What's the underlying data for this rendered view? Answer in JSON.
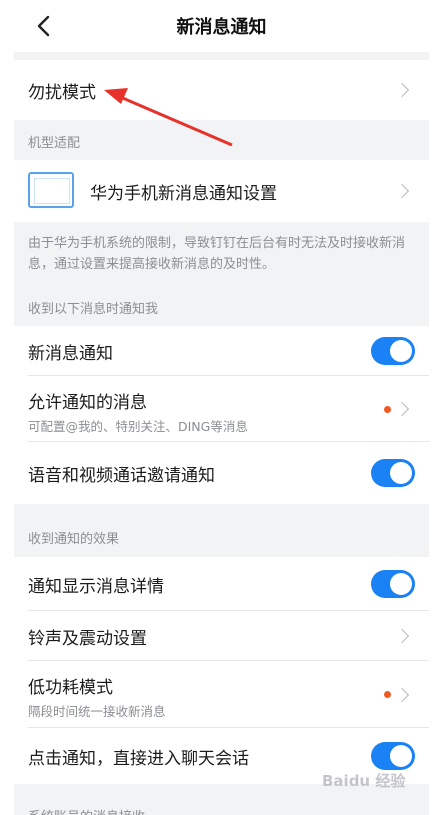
{
  "header": {
    "title": "新消息通知",
    "back_icon": "chevron-left-icon"
  },
  "dnd": {
    "label": "勿扰模式"
  },
  "model": {
    "section_title": "机型适配",
    "huawei_label": "华为手机新消息通知设置",
    "note": "由于华为手机系统的限制，导致钉钉在后台有时无法及时接收新消息，通过设置来提高接收新消息的及时性。"
  },
  "notify": {
    "section_title": "收到以下消息时通知我",
    "items": [
      {
        "label": "新消息通知",
        "toggle": true
      },
      {
        "label": "允许通知的消息",
        "sub": "可配置@我的、特别关注、DING等消息"
      },
      {
        "label": "语音和视频通话邀请通知",
        "toggle": true
      }
    ]
  },
  "effects": {
    "section_title": "收到通知的效果",
    "items": [
      {
        "label": "通知显示消息详情",
        "toggle": true
      },
      {
        "label": "铃声及震动设置"
      },
      {
        "label": "低功耗模式",
        "sub": "隔段时间统一接收新消息"
      },
      {
        "label": "点击通知，直接进入聊天会话",
        "toggle": true
      }
    ]
  },
  "footer_cut": {
    "text": "系统账号的消息接收"
  },
  "watermark": {
    "text": "Baidu 经验"
  },
  "colors": {
    "accent": "#1a82f4",
    "dot": "#f25a21",
    "arrow": "#e8312a"
  }
}
